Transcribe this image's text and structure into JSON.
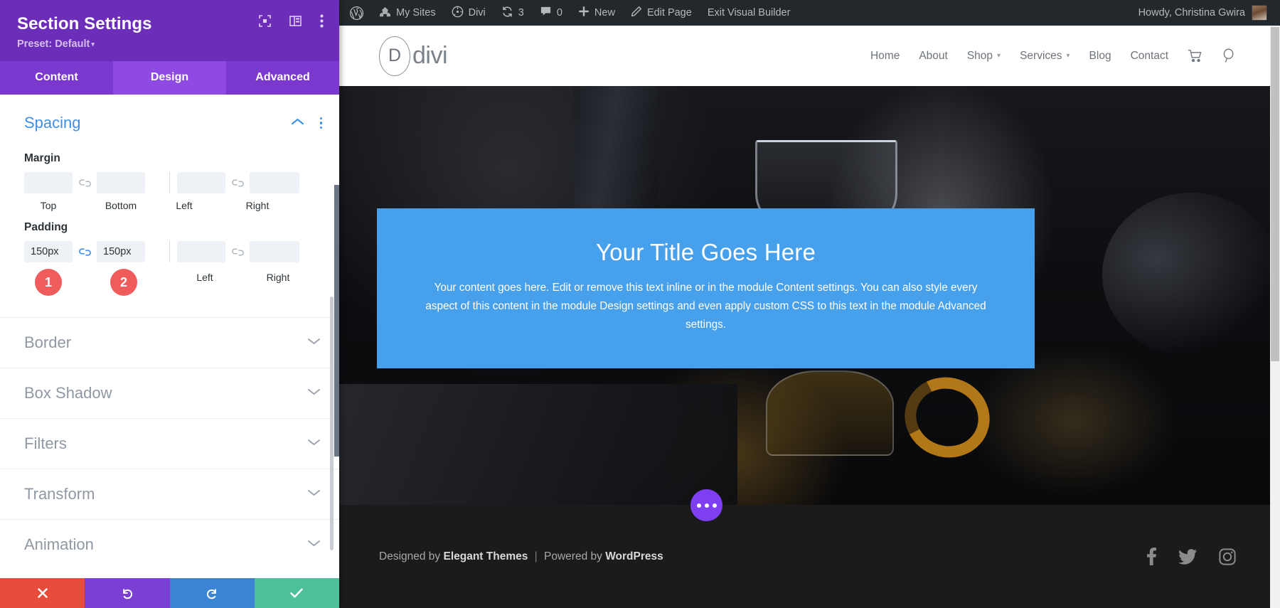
{
  "panel": {
    "title": "Section Settings",
    "preset_label": "Preset: Default",
    "head_icons": [
      "focus-icon",
      "layout-icon",
      "more-vertical-icon"
    ],
    "tabs": [
      {
        "label": "Content",
        "active": false
      },
      {
        "label": "Design",
        "active": true
      },
      {
        "label": "Advanced",
        "active": false
      }
    ],
    "spacing": {
      "title": "Spacing",
      "margin": {
        "label": "Margin",
        "top": {
          "value": "",
          "placeholder": "",
          "caption": "Top"
        },
        "bottom": {
          "value": "",
          "placeholder": "",
          "caption": "Bottom"
        },
        "left": {
          "value": "",
          "placeholder": "",
          "caption": "Left"
        },
        "right": {
          "value": "",
          "placeholder": "",
          "caption": "Right"
        }
      },
      "padding": {
        "label": "Padding",
        "top": {
          "value": "150px",
          "caption": "Top",
          "badge": "1"
        },
        "bottom": {
          "value": "150px",
          "caption": "Bottom",
          "badge": "2"
        },
        "left": {
          "value": "",
          "caption": "Left"
        },
        "right": {
          "value": "",
          "caption": "Right"
        }
      },
      "link_icon_padding_active": true
    },
    "collapsed_sections": [
      {
        "label": "Border"
      },
      {
        "label": "Box Shadow"
      },
      {
        "label": "Filters"
      },
      {
        "label": "Transform"
      },
      {
        "label": "Animation"
      }
    ],
    "footer_buttons": [
      {
        "name": "cancel",
        "icon": "close-icon",
        "color": "#e74b3c"
      },
      {
        "name": "undo",
        "icon": "undo-icon",
        "color": "#7b3fd4"
      },
      {
        "name": "redo",
        "icon": "redo-icon",
        "color": "#3b83d3"
      },
      {
        "name": "save",
        "icon": "check-icon",
        "color": "#4ec09a"
      }
    ],
    "accent_color": "#6c2eb9",
    "badge_color": "#f05b5b",
    "link_color": "#3e8fe8"
  },
  "admin_bar": {
    "items": [
      {
        "label": "",
        "icon": "wordpress-logo-icon"
      },
      {
        "label": "My Sites",
        "icon": "sites-icon"
      },
      {
        "label": "Divi",
        "icon": "divi-dashboard-icon"
      },
      {
        "label": "3",
        "icon": "updates-icon"
      },
      {
        "label": "0",
        "icon": "comments-icon"
      },
      {
        "label": "New",
        "icon": "plus-icon"
      },
      {
        "label": "Edit Page",
        "icon": "pencil-icon"
      },
      {
        "label": "Exit Visual Builder",
        "icon": ""
      }
    ],
    "howdy": "Howdy, Christina Gwira"
  },
  "site_header": {
    "logo_letter": "D",
    "logo_word": "divi",
    "nav": [
      {
        "label": "Home",
        "has_dropdown": false
      },
      {
        "label": "About",
        "has_dropdown": false
      },
      {
        "label": "Shop",
        "has_dropdown": true
      },
      {
        "label": "Services",
        "has_dropdown": true
      },
      {
        "label": "Blog",
        "has_dropdown": false
      },
      {
        "label": "Contact",
        "has_dropdown": false
      }
    ],
    "icons": [
      "cart-icon",
      "search-icon"
    ]
  },
  "hero": {
    "box_color": "#46a0ec",
    "title": "Your Title Goes Here",
    "body": "Your content goes here. Edit or remove this text inline or in the module Content settings. You can also style every aspect of this content in the module Design settings and even apply custom CSS to this text in the module Advanced settings."
  },
  "site_footer": {
    "designed_by": "Designed by",
    "designer": "Elegant Themes",
    "separator": "|",
    "powered_by": "Powered by",
    "platform": "WordPress",
    "socials": [
      "facebook-icon",
      "twitter-icon",
      "instagram-icon"
    ],
    "fab": "more-options-icon"
  }
}
